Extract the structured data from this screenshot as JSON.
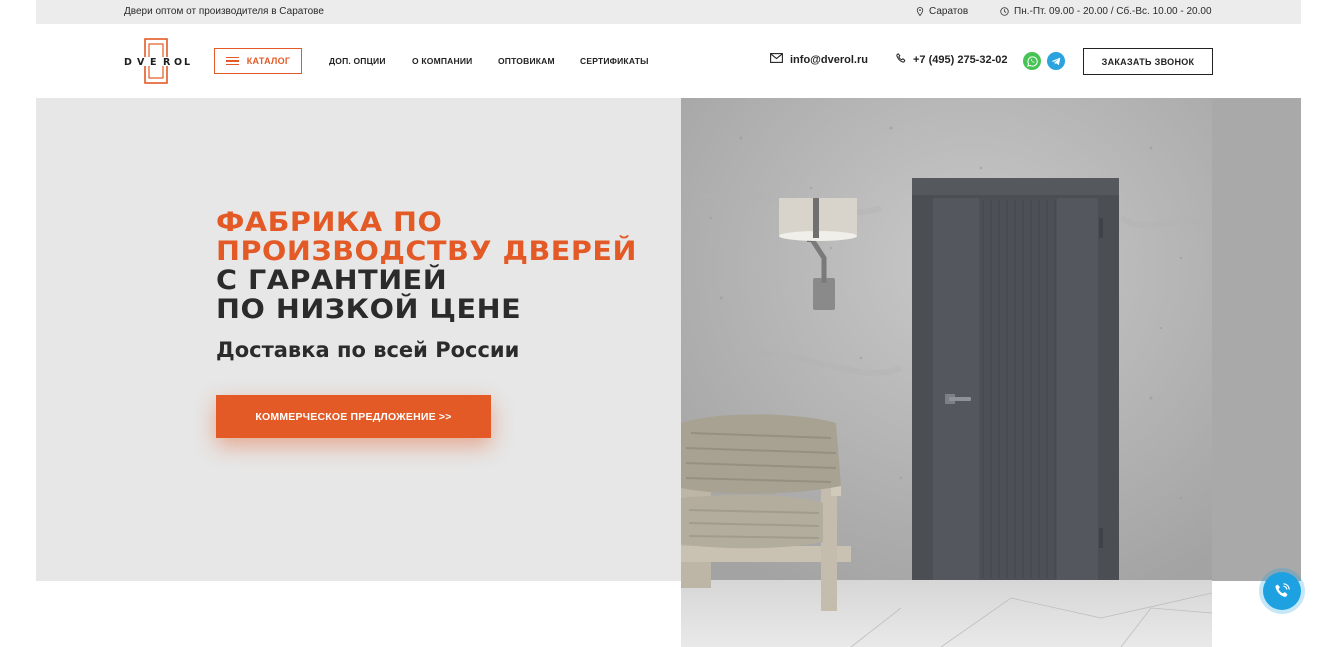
{
  "topbar": {
    "tagline": "Двери оптом от производителя в Саратове",
    "city": "Саратов",
    "hours": "Пн.-Пт. 09.00 - 20.00 / Сб.-Вс. 10.00 - 20.00"
  },
  "header": {
    "logo_text": "DVEROL",
    "catalog_label": "КАТАЛОГ",
    "nav": [
      "ДОП. ОПЦИИ",
      "О КОМПАНИИ",
      "ОПТОВИКАМ",
      "СЕРТИФИКАТЫ"
    ],
    "email": "info@dverol.ru",
    "phone": "+7 (495) 275-32-02",
    "callback_label": "ЗАКАЗАТЬ ЗВОНОК"
  },
  "hero": {
    "title_accent": [
      "ФАБРИКА ПО",
      "ПРОИЗВОДСТВУ ДВЕРЕЙ"
    ],
    "title_dark": [
      "С ГАРАНТИЕЙ",
      "ПО НИЗКОЙ ЦЕНЕ"
    ],
    "subtitle": "Доставка по всей России",
    "cta_label": "КОММЕРЧЕСКОЕ ПРЕДЛОЖЕНИЕ >>"
  },
  "icons": {
    "city": "location-pin-icon",
    "hours": "clock-icon",
    "email": "envelope-icon",
    "phone": "phone-icon",
    "whatsapp": "whatsapp-icon",
    "telegram": "telegram-icon",
    "float_call": "phone-call-icon"
  },
  "colors": {
    "accent": "#e35a26",
    "dark": "#2b2b2b",
    "hero_bg": "#e7e7e7",
    "whatsapp": "#47c356",
    "telegram": "#2aa3df",
    "float_call": "#1da1e0"
  }
}
